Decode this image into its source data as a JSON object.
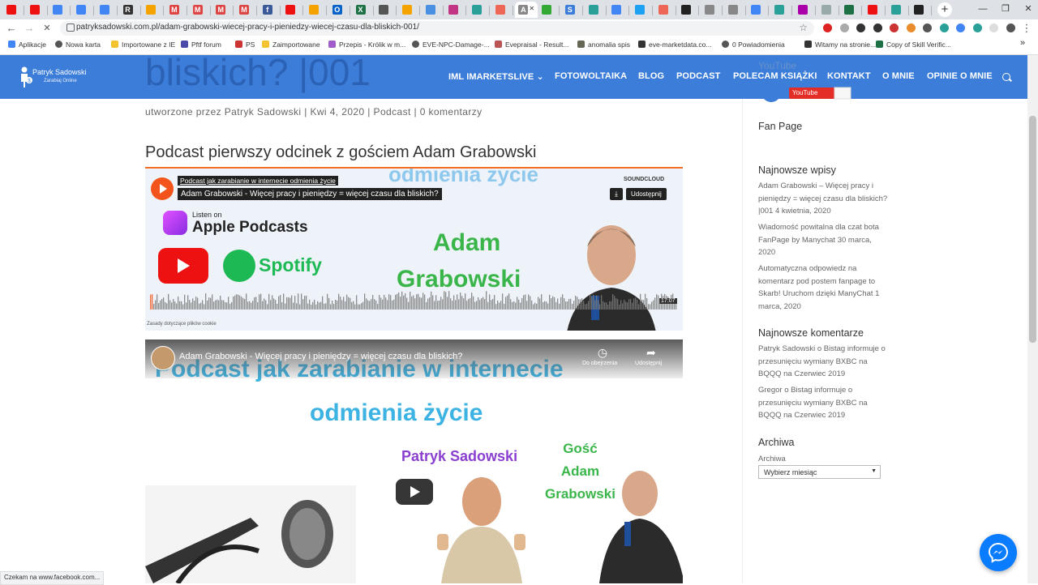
{
  "browser": {
    "tabs": [
      {
        "icon": "youtube-favicon",
        "color": "#e11"
      },
      {
        "icon": "youtube-favicon",
        "color": "#e11"
      },
      {
        "icon": "google-favicon",
        "color": "#4285f4"
      },
      {
        "icon": "google-favicon",
        "color": "#4285f4"
      },
      {
        "icon": "google-favicon",
        "color": "#4285f4"
      },
      {
        "icon": "r-favicon",
        "color": "#333",
        "letter": "R"
      },
      {
        "icon": "google-favicon",
        "color": "#f4a300"
      },
      {
        "icon": "gmail-favicon",
        "color": "#d44",
        "letter": "M"
      },
      {
        "icon": "gmail-favicon",
        "color": "#d44",
        "letter": "M"
      },
      {
        "icon": "gmail-favicon",
        "color": "#d44",
        "letter": "M"
      },
      {
        "icon": "gmail-favicon",
        "color": "#d44",
        "letter": "M"
      },
      {
        "icon": "facebook-favicon",
        "color": "#3b5998",
        "letter": "f"
      },
      {
        "icon": "youtube-favicon",
        "color": "#e11"
      },
      {
        "icon": "smile-favicon",
        "color": "#f4a300"
      },
      {
        "icon": "outlook-favicon",
        "color": "#0a64c8",
        "letter": "O"
      },
      {
        "icon": "excel-favicon",
        "color": "#1e7145",
        "letter": "X"
      },
      {
        "icon": "arrow-favicon",
        "color": "#555"
      },
      {
        "icon": "chart-favicon",
        "color": "#f4a300"
      },
      {
        "icon": "cloud-favicon",
        "color": "#4a90e2"
      },
      {
        "icon": "instagram-favicon",
        "color": "#c13584"
      },
      {
        "icon": "site-favicon",
        "color": "#2aa198"
      },
      {
        "icon": "site-favicon",
        "color": "#e65"
      },
      {
        "icon": "active-favicon",
        "color": "#888",
        "letter": "A"
      },
      {
        "icon": "chart-favicon",
        "color": "#3a3"
      },
      {
        "icon": "site-favicon",
        "color": "#3b7dd8",
        "letter": "S"
      },
      {
        "icon": "site-favicon",
        "color": "#2aa198"
      },
      {
        "icon": "google-favicon",
        "color": "#4285f4"
      },
      {
        "icon": "twitter-favicon",
        "color": "#1da1f2"
      },
      {
        "icon": "site-favicon",
        "color": "#e65"
      },
      {
        "icon": "spotify-favicon",
        "color": "#222"
      },
      {
        "icon": "site-favicon",
        "color": "#888"
      },
      {
        "icon": "site-favicon",
        "color": "#888"
      },
      {
        "icon": "docs-favicon",
        "color": "#4285f4"
      },
      {
        "icon": "search-favicon",
        "color": "#2aa198"
      },
      {
        "icon": "site-favicon",
        "color": "#a0a"
      },
      {
        "icon": "site-favicon",
        "color": "#9aa"
      },
      {
        "icon": "sheets-favicon",
        "color": "#1e7145"
      },
      {
        "icon": "youtube-favicon",
        "color": "#e11"
      },
      {
        "icon": "site-favicon",
        "color": "#2aa198"
      },
      {
        "icon": "site-favicon",
        "color": "#222"
      }
    ],
    "active_tab_letter": "A",
    "close_glyph": "✕",
    "new_tab_glyph": "+",
    "win_minimize": "—",
    "win_maximize": "❐",
    "win_close": "✕",
    "back_glyph": "←",
    "forward_glyph": "→",
    "reload_glyph": "✕",
    "url": "patryksadowski.com.pl/adam-grabowski-wiecej-pracy-i-pieniedzy-wiecej-czasu-dla-bliskich-001/",
    "star_glyph": "☆",
    "menu_glyph": "⋮",
    "bookmarks": [
      {
        "label": "Aplikacje",
        "icon": "apps-icon",
        "color": "#4285f4"
      },
      {
        "label": "Nowa karta",
        "icon": "globe-icon",
        "color": "#555"
      },
      {
        "label": "Importowane z IE",
        "icon": "folder-icon",
        "color": "#f4c430"
      },
      {
        "label": "Pftf forum",
        "icon": "site-icon",
        "color": "#4a4aa8"
      },
      {
        "label": "PS",
        "icon": "site-icon",
        "color": "#c33"
      },
      {
        "label": "Zaimportowane",
        "icon": "folder-icon",
        "color": "#f4c430"
      },
      {
        "label": "Przepis - Królik w m...",
        "icon": "site-icon",
        "color": "#a05cc8"
      },
      {
        "label": "EVE-NPC-Damage-...",
        "icon": "globe-icon",
        "color": "#555"
      },
      {
        "label": "Evepraisal - Result...",
        "icon": "site-icon",
        "color": "#b55"
      },
      {
        "label": "anomalia spis",
        "icon": "site-icon",
        "color": "#665"
      },
      {
        "label": "eve-marketdata.co...",
        "icon": "site-icon",
        "color": "#333"
      },
      {
        "label": "0 Powiadomienia",
        "icon": "globe-icon",
        "color": "#555"
      },
      {
        "label": "Witamy na stronie...",
        "icon": "site-icon",
        "color": "#333"
      },
      {
        "label": "Copy of Skill Verific...",
        "icon": "sheets-icon",
        "color": "#1e7145"
      }
    ],
    "bookmarks_more": "»",
    "status_text": "Czekam na www.facebook.com..."
  },
  "site": {
    "logo_name": "Patryk Sadowski",
    "logo_tagline": "Zarabiaj Online",
    "menu": [
      {
        "label": "IML IMARKETSLIVE",
        "has_dropdown": true
      },
      {
        "label": "FOTOWOLTAIKA"
      },
      {
        "label": "BLOG"
      },
      {
        "label": "PODCAST"
      },
      {
        "label": "POLECAM KSIĄŻKI"
      },
      {
        "label": "KONTAKT"
      },
      {
        "label": "O MNIE"
      },
      {
        "label": "OPINIE O MNIE"
      }
    ],
    "dropdown_glyph": "⌄",
    "brand_color": "#3b7dd8",
    "title_fragment": "bliskich? |001",
    "sidebar_youtube_title": "YouTube",
    "yt_subscribe": "YouTube"
  },
  "post": {
    "meta": "utworzone przez Patryk Sadowski | Kwi 4, 2020 | Podcast | 0 komentarzy",
    "heading": "Podcast pierwszy odcinek z gościem Adam Grabowski",
    "soundcloud": {
      "small_title": "Podcast jak zarabianie w internecie odmienia życie",
      "track_title": "Adam Grabowski - Więcej pracy i pieniędzy = więcej czasu dla bliskich?",
      "logo": "SOUNDCLOUD",
      "share": "Udostępnij",
      "download_glyph": "⤓",
      "time": "17:07",
      "cookie": "Zasady dotyczące plików cookie",
      "art_top": "odmienia życie",
      "art_name1": "Adam",
      "art_name2": "Grabowski",
      "apple_listen": "Listen on",
      "apple_text": "Apple Podcasts",
      "spotify": "Spotify",
      "waveform_seed": 17
    },
    "youtube": {
      "title": "Adam Grabowski - Więcej pracy i pieniędzy = więcej czasu dla bliskich?",
      "watch_later": "Do obejrzenia",
      "share": "Udostępnij",
      "heading1": "Podcast jak zarabianie w internecie",
      "heading2": "odmienia życie",
      "host": "Patryk Sadowski",
      "guest1": "Gość",
      "guest2": "Adam",
      "guest3": "Grabowski"
    }
  },
  "sidebar": {
    "fanpage": "Fan Page",
    "latest_posts_title": "Najnowsze wpisy",
    "latest_posts": [
      "Adam Grabowski – Więcej pracy i pieniędzy = więcej czasu dla bliskich? |001 4 kwietnia, 2020",
      "Wiadomość powitalna dla czat bota FanPage by Manychat 30 marca, 2020",
      "Automatyczna odpowiedz na komentarz pod postem fanpage to Skarb! Uruchom dzięki ManyChat 1 marca, 2020"
    ],
    "latest_comments_title": "Najnowsze komentarze",
    "latest_comments": [
      "Patryk Sadowski o Bistag informuje o przesunięciu wymiany BXBC na BQQQ na Czerwiec 2019",
      "Gregor o Bistag informuje o przesunięciu wymiany BXBC na BQQQ na Czerwiec 2019"
    ],
    "archive_title": "Archiwa",
    "archive_label": "Archiwa",
    "archive_select": "Wybierz miesiąc",
    "archive_arrow": "▼"
  }
}
